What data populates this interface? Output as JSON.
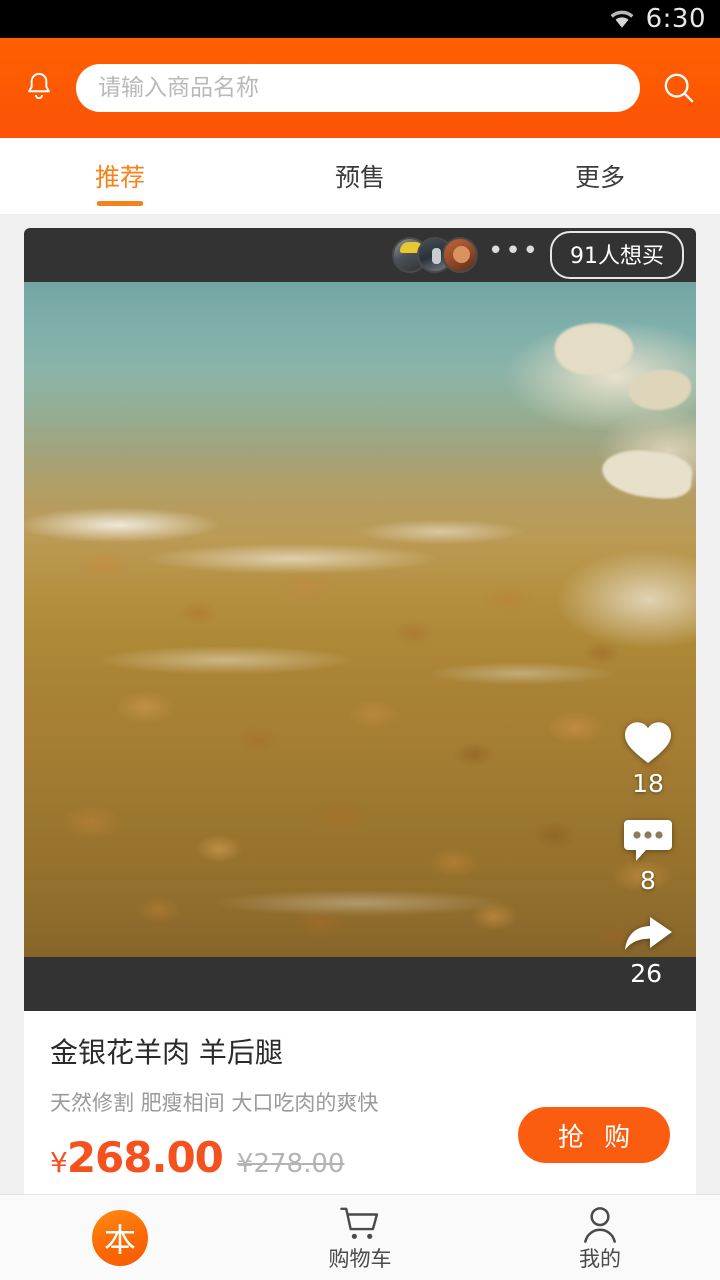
{
  "status_bar": {
    "time": "6:30",
    "wifi_icon": "wifi-icon"
  },
  "header": {
    "bell_icon": "bell-icon",
    "search_icon": "search-icon",
    "search": {
      "value": "",
      "placeholder": "请输入商品名称"
    },
    "background_color": "#fb5c06"
  },
  "tabs": {
    "items": [
      {
        "label": "推荐",
        "active": true
      },
      {
        "label": "预售",
        "active": false
      },
      {
        "label": "更多",
        "active": false
      }
    ],
    "active_color": "#f7821b"
  },
  "card": {
    "head": {
      "avatars": [
        "avatar-1",
        "avatar-2",
        "avatar-3"
      ],
      "more_dots": "•••",
      "want_badge": "91人想买"
    },
    "video": {
      "alt": "river-stones-water-video",
      "actions": [
        {
          "icon": "heart-icon",
          "count": "18"
        },
        {
          "icon": "comment-icon",
          "count": "8"
        },
        {
          "icon": "share-icon",
          "count": "26"
        }
      ]
    },
    "product": {
      "title": "金银花羊肉 羊后腿",
      "subtitle": "天然修割 肥瘦相间 大口吃肉的爽快",
      "currency": "¥",
      "price": "268.00",
      "original_price": "¥278.00",
      "buy_label": "抢 购",
      "price_color": "#f5511e",
      "buy_button_color": "#fa5d10"
    }
  },
  "bottom_nav": {
    "items": [
      {
        "label": "",
        "icon": "home-logo-icon",
        "glyph": "本"
      },
      {
        "label": "购物车",
        "icon": "cart-icon"
      },
      {
        "label": "我的",
        "icon": "person-icon"
      }
    ]
  }
}
